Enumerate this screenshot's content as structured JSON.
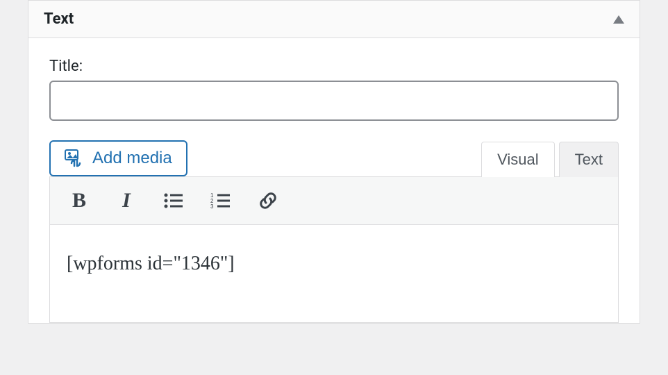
{
  "widget": {
    "header_title": "Text"
  },
  "form": {
    "title_label": "Title:",
    "title_value": ""
  },
  "media": {
    "button_label": "Add media"
  },
  "tabs": {
    "visual": "Visual",
    "text": "Text",
    "active": "visual"
  },
  "toolbar": {
    "bold_glyph": "B",
    "italic_glyph": "I"
  },
  "editor": {
    "content": "[wpforms id=\"1346\"]"
  }
}
